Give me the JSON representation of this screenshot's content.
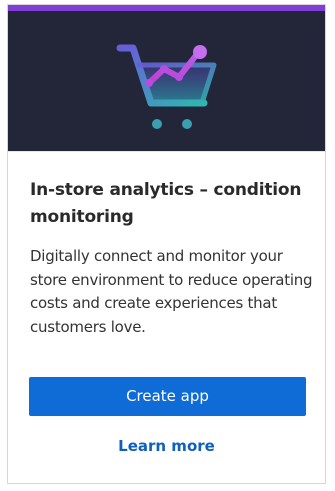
{
  "card": {
    "hero_icon": "shopping-cart-analytics-icon",
    "title": "In-store analytics – condition monitoring",
    "description": "Digitally connect and monitor your store environment to reduce operating costs and create experiences that customers love.",
    "create_button_label": "Create app",
    "learn_more_label": "Learn more"
  },
  "colors": {
    "accent_bar": "#7f3fd6",
    "hero_background": "#232539",
    "primary_button": "#0f6cd6",
    "link": "#0f5fbf"
  }
}
